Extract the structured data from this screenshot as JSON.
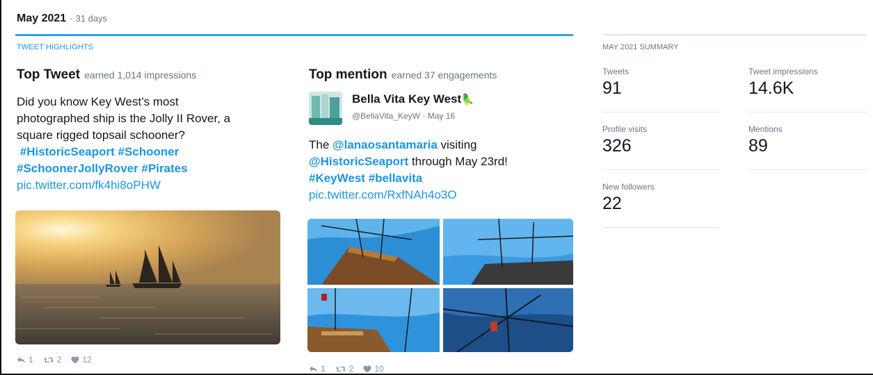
{
  "header": {
    "month": "May 2021",
    "separator": "·",
    "days": "31 days"
  },
  "highlights": {
    "label": "TWEET HIGHLIGHTS"
  },
  "top_tweet": {
    "title": "Top Tweet",
    "subtitle": "earned 1,014 impressions",
    "text_lines": [
      "Did you know Key West’s most",
      "photographed ship is the Jolly II Rover, a",
      "square rigged topsail schooner?"
    ],
    "hashtags_line1": [
      "#HistoricSeaport",
      "#Schooner"
    ],
    "hashtags_line2": [
      "#SchoonerJollyRover",
      "#Pirates"
    ],
    "link": "pic.twitter.com/fk4hi8oPHW",
    "actions": {
      "replies": "1",
      "retweets": "2",
      "likes": "12"
    }
  },
  "top_mention": {
    "title": "Top mention",
    "subtitle": "earned 37 engagements",
    "author_name": "Bella Vita Key West",
    "author_emoji": "🦜",
    "author_handle": "@BellaVita_KeyW",
    "date": "May 16",
    "text_the": "The",
    "mention1": "@lanaosantamaria",
    "text_visiting": "visiting",
    "mention2": "@HistoricSeaport",
    "text_through": "through May 23rd!",
    "hashtags": [
      "#KeyWest",
      "#bellavita"
    ],
    "link": "pic.twitter.com/RxfNAh4o3O",
    "actions": {
      "replies": "1",
      "retweets": "2",
      "likes": "10"
    }
  },
  "summary": {
    "label": "MAY 2021 SUMMARY",
    "tweets_label": "Tweets",
    "tweets_value": "91",
    "impressions_label": "Tweet impressions",
    "impressions_value": "14.6K",
    "visits_label": "Profile visits",
    "visits_value": "326",
    "mentions_label": "Mentions",
    "mentions_value": "89",
    "followers_label": "New followers",
    "followers_value": "22"
  },
  "colors": {
    "accent": "#1b95e0",
    "bar": "#2aa3ef",
    "muted": "#657786"
  }
}
